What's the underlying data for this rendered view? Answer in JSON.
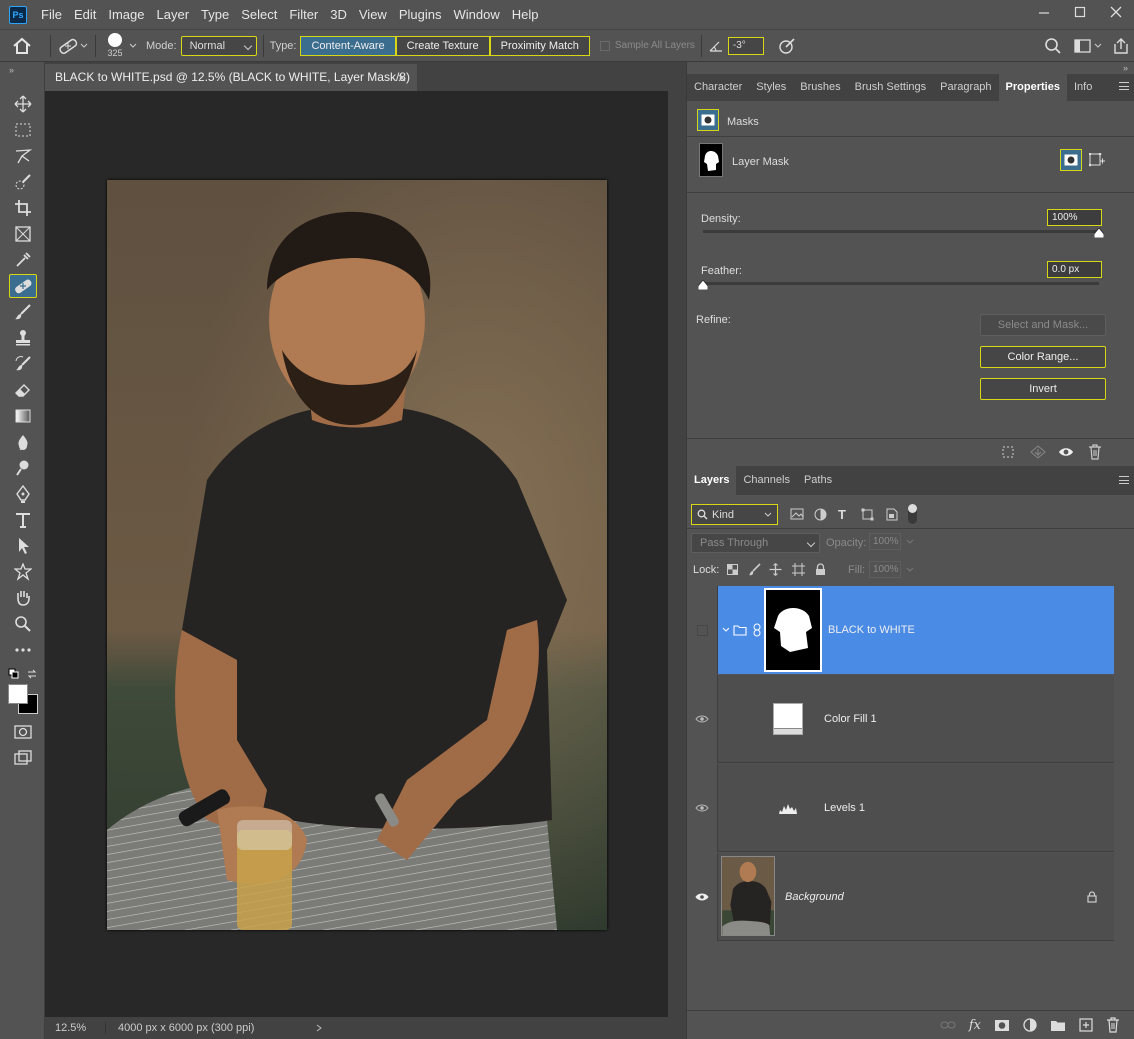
{
  "app": {
    "logo_text": "Ps",
    "menu": [
      "File",
      "Edit",
      "Image",
      "Layer",
      "Type",
      "Select",
      "Filter",
      "3D",
      "View",
      "Plugins",
      "Window",
      "Help"
    ]
  },
  "options_bar": {
    "brush_size": "325",
    "mode_label": "Mode:",
    "mode_value": "Normal",
    "type_label": "Type:",
    "type_options": [
      "Content-Aware",
      "Create Texture",
      "Proximity Match"
    ],
    "sample_all_layers": "Sample All Layers",
    "angle_value": "-3°"
  },
  "document": {
    "tab_title": "BLACK to WHITE.psd @ 12.5% (BLACK to WHITE, Layer Mask/8) *",
    "zoom": "12.5%",
    "doc_info": "4000 px x 6000 px (300 ppi)"
  },
  "properties_panel": {
    "tabs": [
      "Character",
      "Styles",
      "Brushes",
      "Brush Settings",
      "Paragraph",
      "Properties",
      "Info"
    ],
    "active_tab": "Properties",
    "section": "Masks",
    "mask_type": "Layer Mask",
    "density_label": "Density:",
    "density_value": "100%",
    "feather_label": "Feather:",
    "feather_value": "0.0 px",
    "refine_label": "Refine:",
    "select_mask": "Select and Mask...",
    "color_range": "Color Range...",
    "invert": "Invert",
    "density_level": 1.0,
    "feather_level": 0.0
  },
  "layers_panel": {
    "tabs": [
      "Layers",
      "Channels",
      "Paths"
    ],
    "active_tab": "Layers",
    "filter_kind": "Kind",
    "blend_mode": "Pass Through",
    "opacity_label": "Opacity:",
    "opacity_value": "100%",
    "lock_label": "Lock:",
    "fill_label": "Fill:",
    "fill_value": "100%",
    "layers": [
      {
        "name": "BLACK to WHITE",
        "kind": "group-with-mask",
        "selected": true
      },
      {
        "name": "Color Fill 1",
        "kind": "color-fill"
      },
      {
        "name": "Levels 1",
        "kind": "levels"
      },
      {
        "name": "Background",
        "kind": "image",
        "locked": true
      }
    ]
  },
  "colors": {
    "accent_highlight": "#d7d715",
    "selected_layer": "#4a8be6",
    "active_tool": "#3a6d8e"
  }
}
